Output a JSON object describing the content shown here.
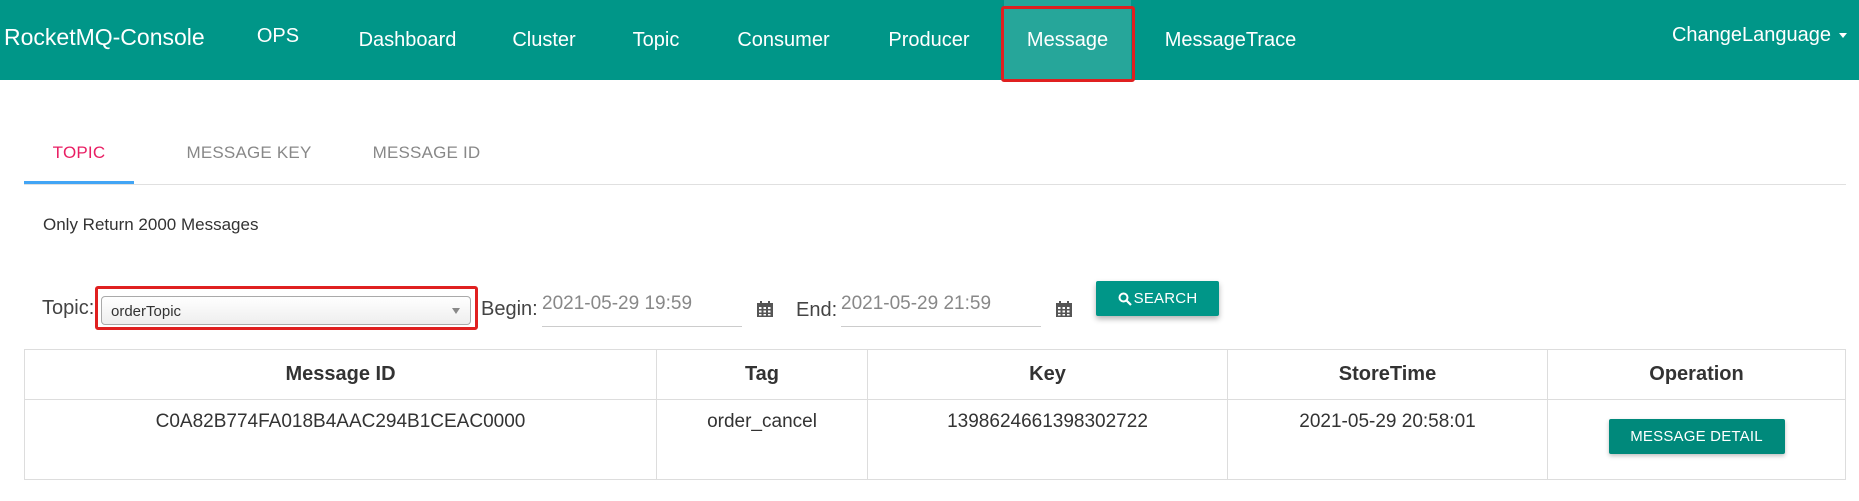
{
  "nav": {
    "brand": "RocketMQ-Console",
    "items": [
      {
        "label": "OPS"
      },
      {
        "label": "Dashboard"
      },
      {
        "label": "Cluster"
      },
      {
        "label": "Topic"
      },
      {
        "label": "Consumer"
      },
      {
        "label": "Producer"
      },
      {
        "label": "Message",
        "active": true
      },
      {
        "label": "MessageTrace"
      }
    ],
    "language": "ChangeLanguage"
  },
  "tabs": [
    {
      "label": "TOPIC",
      "active": true
    },
    {
      "label": "MESSAGE KEY"
    },
    {
      "label": "MESSAGE ID"
    }
  ],
  "note": "Only Return 2000 Messages",
  "search": {
    "topic_label": "Topic:",
    "topic_value": "orderTopic",
    "begin_label": "Begin:",
    "begin_value": "2021-05-29 19:59",
    "end_label": "End:",
    "end_value": "2021-05-29 21:59",
    "button_label": "SEARCH",
    "button_icon": "search-icon",
    "calendar_icon": "calendar-icon"
  },
  "table": {
    "headers": [
      "Message ID",
      "Tag",
      "Key",
      "StoreTime",
      "Operation"
    ],
    "rows": [
      {
        "message_id": "C0A82B774FA018B4AAC294B1CEAC0000",
        "tag": "order_cancel",
        "key": "1398624661398302722",
        "store_time": "2021-05-29 20:58:01",
        "operation": "MESSAGE DETAIL"
      }
    ]
  },
  "colors": {
    "navbar": "#009688",
    "active_nav": "#26a69a",
    "active_tab_text": "#e91e63",
    "tab_indicator": "#42a5f5",
    "highlight": "#e02020",
    "button": "#009688"
  }
}
